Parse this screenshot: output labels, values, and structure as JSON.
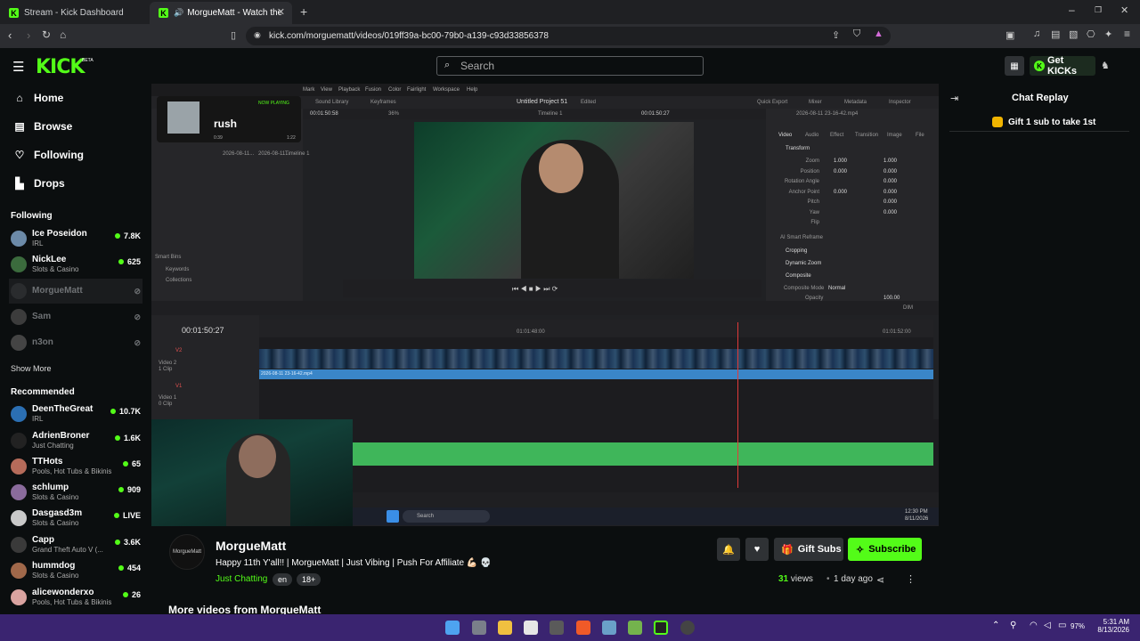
{
  "browser": {
    "tabs": [
      {
        "label": "Stream - Kick Dashboard"
      },
      {
        "label": "MorgueMatt - Watch the VO"
      }
    ],
    "url": "kick.com/morguematt/videos/019ff39a-bc00-79b0-a139-c93d33856378"
  },
  "header": {
    "logo": "KICK",
    "beta": "BETA",
    "search_placeholder": "Search",
    "get_kicks": "Get KICKs"
  },
  "sidebar": {
    "nav": [
      "Home",
      "Browse",
      "Following",
      "Drops"
    ],
    "following_header": "Following",
    "following": [
      {
        "name": "Ice Poseidon",
        "category": "IRL",
        "viewers": "7.8K"
      },
      {
        "name": "NickLee",
        "category": "Slots & Casino",
        "viewers": "625"
      },
      {
        "name": "MorgueMatt",
        "category": "",
        "viewers": ""
      },
      {
        "name": "Sam",
        "category": "",
        "viewers": ""
      },
      {
        "name": "n3on",
        "category": "",
        "viewers": ""
      }
    ],
    "show_more": "Show More",
    "recommended_header": "Recommended",
    "recommended": [
      {
        "name": "DeenTheGreat",
        "category": "IRL",
        "viewers": "10.7K"
      },
      {
        "name": "AdrienBroner",
        "category": "Just Chatting",
        "viewers": "1.6K"
      },
      {
        "name": "TTHots",
        "category": "Pools, Hot Tubs & Bikinis",
        "viewers": "65"
      },
      {
        "name": "schlump",
        "category": "Slots & Casino",
        "viewers": "909"
      },
      {
        "name": "Dasgasd3m",
        "category": "Slots & Casino",
        "viewers": "LIVE"
      },
      {
        "name": "Capp",
        "category": "Grand Theft Auto V (...",
        "viewers": "3.6K"
      },
      {
        "name": "hummdog",
        "category": "Slots & Casino",
        "viewers": "454"
      },
      {
        "name": "alicewonderxo",
        "category": "Pools, Hot Tubs & Bikinis",
        "viewers": "26"
      }
    ]
  },
  "video": {
    "resolve": {
      "project": "Untitled Project 51",
      "edited": "Edited",
      "timecode": "00:01:50:27",
      "viewer_tc_left": "00:01:50:58",
      "viewer_tc_right": "00:01:50:27",
      "timeline": "Timeline 1",
      "zoom": "36%",
      "inspector_file": "2026-08-11 23-16-42.mp4",
      "menus": [
        "Mark",
        "View",
        "Playback",
        "Fusion",
        "Color",
        "Fairlight",
        "Workspace",
        "Help"
      ],
      "toolbar": [
        "Sound Library",
        "Keyframes",
        "Quick Export",
        "Mixer",
        "Metadata",
        "Inspector"
      ],
      "inspector_tabs": [
        "Video",
        "Audio",
        "Effect",
        "Transition",
        "Image",
        "File"
      ],
      "inspector_rows": [
        {
          "label": "Zoom",
          "x": "1.000",
          "y": "1.000"
        },
        {
          "label": "Position",
          "x": "0.000",
          "y": "0.000"
        },
        {
          "label": "Rotation Angle",
          "x": "",
          "y": "0.000"
        },
        {
          "label": "Anchor Point",
          "x": "0.000",
          "y": "0.000"
        },
        {
          "label": "Pitch",
          "x": "",
          "y": "0.000"
        },
        {
          "label": "Yaw",
          "x": "",
          "y": "0.000"
        },
        {
          "label": "Flip",
          "x": "",
          "y": ""
        }
      ],
      "sections": [
        "Transform",
        "AI Smart Reframe",
        "Cropping",
        "Dynamic Zoom",
        "Composite"
      ],
      "composite_mode_label": "Composite Mode",
      "composite_mode": "Normal",
      "opacity_label": "Opacity",
      "opacity": "100.00",
      "track_v2": "V2",
      "track_v2_name": "Video 2",
      "track_v2_clips": "1 Clip",
      "track_v1": "V1",
      "track_v1_name": "Video 1",
      "track_v1_clips": "0 Clip",
      "clip_name": "2026-08-11 23-16-42.mp4",
      "ruler_marks": [
        "01:01:48:00",
        "01:01:52:00"
      ],
      "smart_bins": "Smart Bins",
      "keywords": "Keywords",
      "collections": "Collections",
      "media_clips": [
        "2026-08-11...",
        "2026-08-11...",
        "Timeline 1"
      ],
      "dim": "DIM",
      "search": "Search",
      "win_time": "12:30 PM",
      "win_date": "8/11/2026"
    },
    "popup": {
      "status": "NOW PLAYING",
      "song": "rush",
      "time_left": "0:39",
      "time_right": "1:22"
    }
  },
  "stream": {
    "avatar_text": "MorgueMatt",
    "name": "MorgueMatt",
    "title": "Happy 11th Y'all!! | MorgueMatt  | Just Vibing | Push For Affiliate 💪🏻 💀",
    "category": "Just Chatting",
    "tags": [
      "en",
      "18+"
    ],
    "gift_subs": "Gift Subs",
    "subscribe": "Subscribe",
    "views_count": "31",
    "views_label": "views",
    "ago": "1 day ago",
    "more_videos": "More videos from MorgueMatt"
  },
  "chat": {
    "title": "Chat Replay",
    "gift_prompt": "Gift 1 sub to take 1st"
  },
  "taskbar": {
    "battery": "97%",
    "time": "5:31 AM",
    "date": "8/13/2026"
  },
  "colors": {
    "accent": "#53fc18",
    "bg": "#0b0e0f",
    "taskbar": "#3a2470",
    "playhead": "#e03a3a"
  }
}
